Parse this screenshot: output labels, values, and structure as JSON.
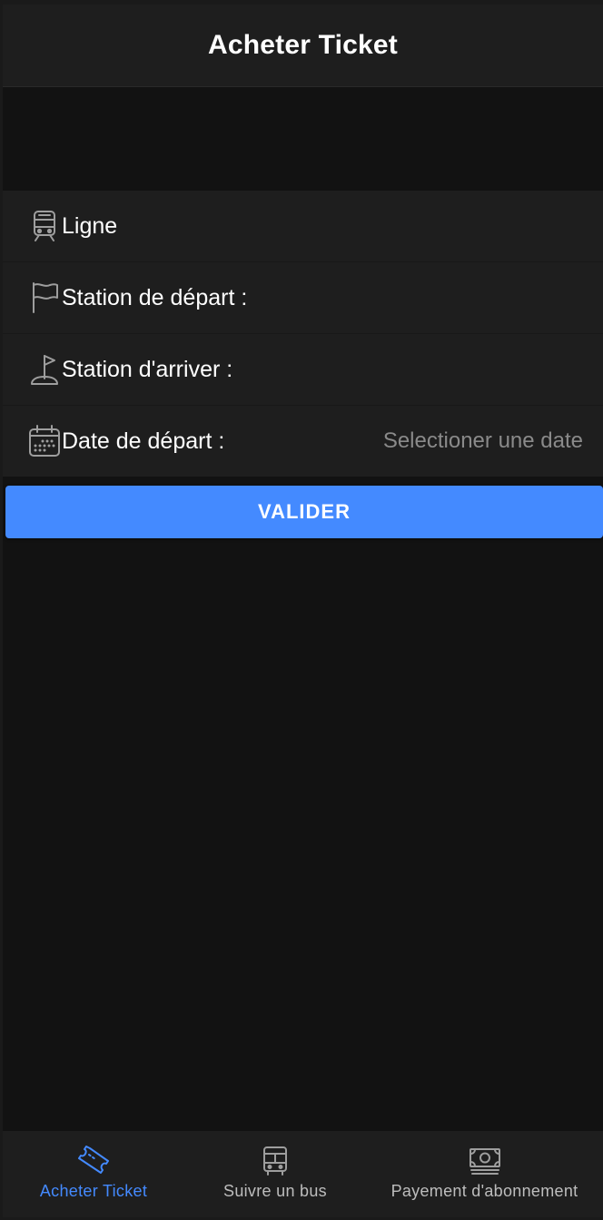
{
  "header": {
    "title": "Acheter Ticket"
  },
  "form": {
    "fields": [
      {
        "label": "Ligne",
        "value": "",
        "icon": "train-icon"
      },
      {
        "label": "Station de départ :",
        "value": "",
        "icon": "flag-icon"
      },
      {
        "label": "Station d'arriver :",
        "value": "",
        "icon": "golf-flag-icon"
      },
      {
        "label": "Date de départ :",
        "value": "Selectioner une date",
        "icon": "calendar-icon"
      }
    ]
  },
  "actions": {
    "validate_label": "VALIDER"
  },
  "bottom_nav": {
    "items": [
      {
        "label": "Acheter Ticket",
        "icon": "ticket-icon",
        "active": true
      },
      {
        "label": "Suivre un bus",
        "icon": "bus-icon",
        "active": false
      },
      {
        "label": "Payement d'abonnement",
        "icon": "money-icon",
        "active": false
      }
    ]
  },
  "colors": {
    "accent": "#448aff",
    "background": "#121212",
    "surface": "#1e1e1e",
    "text": "#ffffff",
    "muted_text": "#8a8a8a",
    "icon_gray": "#9e9e9e"
  }
}
